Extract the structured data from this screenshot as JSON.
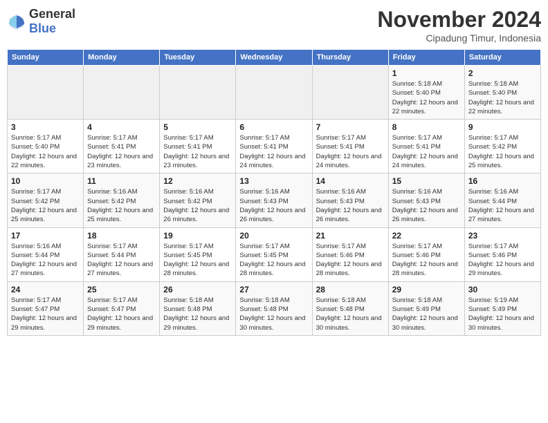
{
  "logo": {
    "text_general": "General",
    "text_blue": "Blue"
  },
  "header": {
    "month": "November 2024",
    "location": "Cipadung Timur, Indonesia"
  },
  "weekdays": [
    "Sunday",
    "Monday",
    "Tuesday",
    "Wednesday",
    "Thursday",
    "Friday",
    "Saturday"
  ],
  "weeks": [
    [
      {
        "day": "",
        "info": ""
      },
      {
        "day": "",
        "info": ""
      },
      {
        "day": "",
        "info": ""
      },
      {
        "day": "",
        "info": ""
      },
      {
        "day": "",
        "info": ""
      },
      {
        "day": "1",
        "info": "Sunrise: 5:18 AM\nSunset: 5:40 PM\nDaylight: 12 hours and 22 minutes."
      },
      {
        "day": "2",
        "info": "Sunrise: 5:18 AM\nSunset: 5:40 PM\nDaylight: 12 hours and 22 minutes."
      }
    ],
    [
      {
        "day": "3",
        "info": "Sunrise: 5:17 AM\nSunset: 5:40 PM\nDaylight: 12 hours and 22 minutes."
      },
      {
        "day": "4",
        "info": "Sunrise: 5:17 AM\nSunset: 5:41 PM\nDaylight: 12 hours and 23 minutes."
      },
      {
        "day": "5",
        "info": "Sunrise: 5:17 AM\nSunset: 5:41 PM\nDaylight: 12 hours and 23 minutes."
      },
      {
        "day": "6",
        "info": "Sunrise: 5:17 AM\nSunset: 5:41 PM\nDaylight: 12 hours and 24 minutes."
      },
      {
        "day": "7",
        "info": "Sunrise: 5:17 AM\nSunset: 5:41 PM\nDaylight: 12 hours and 24 minutes."
      },
      {
        "day": "8",
        "info": "Sunrise: 5:17 AM\nSunset: 5:41 PM\nDaylight: 12 hours and 24 minutes."
      },
      {
        "day": "9",
        "info": "Sunrise: 5:17 AM\nSunset: 5:42 PM\nDaylight: 12 hours and 25 minutes."
      }
    ],
    [
      {
        "day": "10",
        "info": "Sunrise: 5:17 AM\nSunset: 5:42 PM\nDaylight: 12 hours and 25 minutes."
      },
      {
        "day": "11",
        "info": "Sunrise: 5:16 AM\nSunset: 5:42 PM\nDaylight: 12 hours and 25 minutes."
      },
      {
        "day": "12",
        "info": "Sunrise: 5:16 AM\nSunset: 5:42 PM\nDaylight: 12 hours and 26 minutes."
      },
      {
        "day": "13",
        "info": "Sunrise: 5:16 AM\nSunset: 5:43 PM\nDaylight: 12 hours and 26 minutes."
      },
      {
        "day": "14",
        "info": "Sunrise: 5:16 AM\nSunset: 5:43 PM\nDaylight: 12 hours and 26 minutes."
      },
      {
        "day": "15",
        "info": "Sunrise: 5:16 AM\nSunset: 5:43 PM\nDaylight: 12 hours and 26 minutes."
      },
      {
        "day": "16",
        "info": "Sunrise: 5:16 AM\nSunset: 5:44 PM\nDaylight: 12 hours and 27 minutes."
      }
    ],
    [
      {
        "day": "17",
        "info": "Sunrise: 5:16 AM\nSunset: 5:44 PM\nDaylight: 12 hours and 27 minutes."
      },
      {
        "day": "18",
        "info": "Sunrise: 5:17 AM\nSunset: 5:44 PM\nDaylight: 12 hours and 27 minutes."
      },
      {
        "day": "19",
        "info": "Sunrise: 5:17 AM\nSunset: 5:45 PM\nDaylight: 12 hours and 28 minutes."
      },
      {
        "day": "20",
        "info": "Sunrise: 5:17 AM\nSunset: 5:45 PM\nDaylight: 12 hours and 28 minutes."
      },
      {
        "day": "21",
        "info": "Sunrise: 5:17 AM\nSunset: 5:46 PM\nDaylight: 12 hours and 28 minutes."
      },
      {
        "day": "22",
        "info": "Sunrise: 5:17 AM\nSunset: 5:46 PM\nDaylight: 12 hours and 28 minutes."
      },
      {
        "day": "23",
        "info": "Sunrise: 5:17 AM\nSunset: 5:46 PM\nDaylight: 12 hours and 29 minutes."
      }
    ],
    [
      {
        "day": "24",
        "info": "Sunrise: 5:17 AM\nSunset: 5:47 PM\nDaylight: 12 hours and 29 minutes."
      },
      {
        "day": "25",
        "info": "Sunrise: 5:17 AM\nSunset: 5:47 PM\nDaylight: 12 hours and 29 minutes."
      },
      {
        "day": "26",
        "info": "Sunrise: 5:18 AM\nSunset: 5:48 PM\nDaylight: 12 hours and 29 minutes."
      },
      {
        "day": "27",
        "info": "Sunrise: 5:18 AM\nSunset: 5:48 PM\nDaylight: 12 hours and 30 minutes."
      },
      {
        "day": "28",
        "info": "Sunrise: 5:18 AM\nSunset: 5:48 PM\nDaylight: 12 hours and 30 minutes."
      },
      {
        "day": "29",
        "info": "Sunrise: 5:18 AM\nSunset: 5:49 PM\nDaylight: 12 hours and 30 minutes."
      },
      {
        "day": "30",
        "info": "Sunrise: 5:19 AM\nSunset: 5:49 PM\nDaylight: 12 hours and 30 minutes."
      }
    ]
  ]
}
